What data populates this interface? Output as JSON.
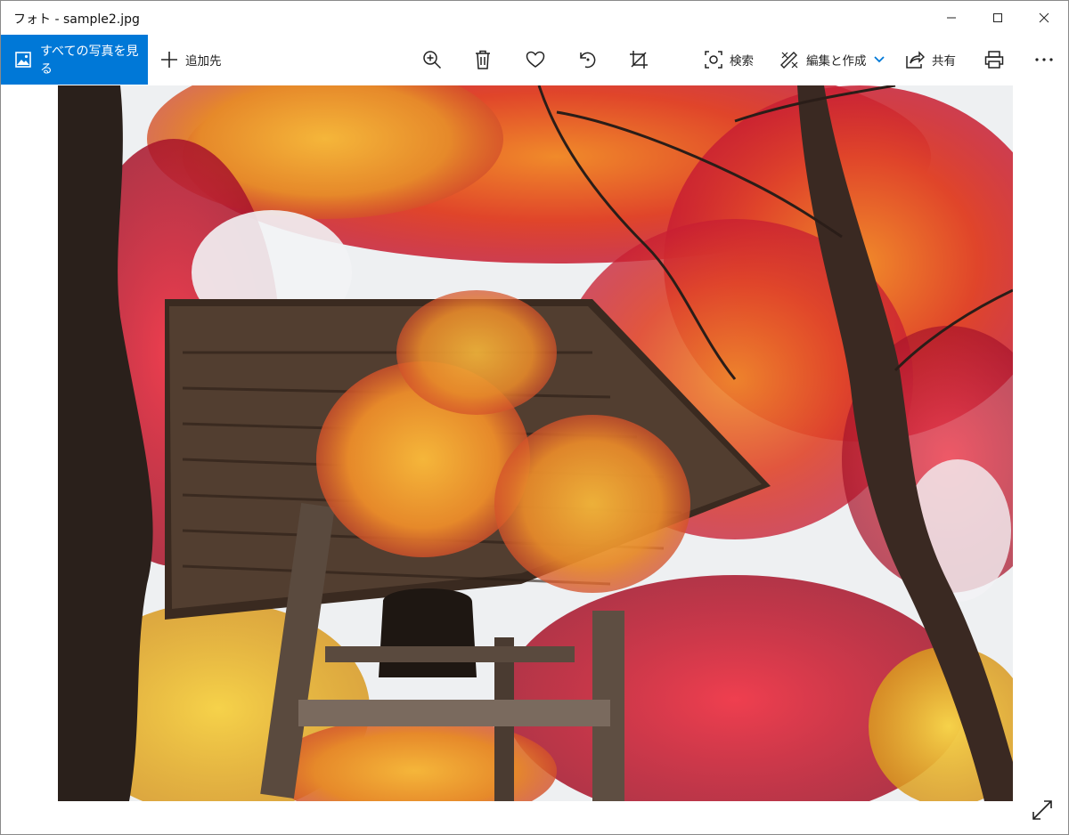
{
  "window": {
    "title": "フォト - sample2.jpg"
  },
  "toolbar": {
    "all_photos_label": "すべての写真を見る",
    "add_to_label": "追加先",
    "search_label": "検索",
    "edit_create_label": "編集と作成",
    "share_label": "共有"
  },
  "colors": {
    "accent": "#0078d7"
  },
  "icons": [
    "image-icon",
    "plus-icon",
    "zoom-in-icon",
    "trash-icon",
    "heart-icon",
    "rotate-icon",
    "crop-icon",
    "visual-search-icon",
    "edit-create-icon",
    "chevron-down-icon",
    "share-icon",
    "print-icon",
    "more-icon",
    "expand-icon",
    "minimize-icon",
    "maximize-icon",
    "close-icon"
  ]
}
